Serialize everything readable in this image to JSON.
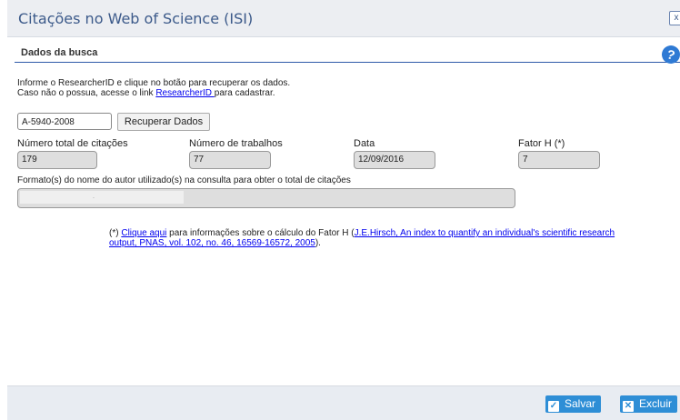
{
  "window": {
    "title": "Citações no Web of Science (ISI)",
    "close_glyph": "x"
  },
  "section": {
    "title": "Dados da busca"
  },
  "info": {
    "line1": "Informe o ResearcherID e clique no botão para recuperar os dados.",
    "line2_prefix": "Caso não o possua, acesse o link ",
    "line2_link": "ResearcherID ",
    "line2_suffix": "para cadastrar."
  },
  "researcher_id": {
    "value": "A-5940-2008"
  },
  "recuperar_button": {
    "label": "Recuperar Dados"
  },
  "fields": {
    "total_citacoes": {
      "label": "Número total de citações",
      "value": "179"
    },
    "num_trabalhos": {
      "label": "Número de trabalhos",
      "value": "77"
    },
    "data": {
      "label": "Data",
      "value": "12/09/2016"
    },
    "fator_h": {
      "label": "Fator H (*)",
      "value": "7"
    }
  },
  "formato": {
    "label": "Formato(s) do nome do autor utilizado(s) na consulta para obter o total de citações",
    "value": "."
  },
  "note": {
    "prefix": "(*) ",
    "link1": "Clique aqui",
    "middle": " para informações sobre o cálculo do Fator H (",
    "link2": "J.E.Hirsch, An index to quantify an individual's scientific research output, PNAS, vol. 102, no. 46, 16569-16572, 2005",
    "suffix": ")."
  },
  "footer": {
    "save_label": "Salvar",
    "delete_label": "Excluir"
  },
  "icons": {
    "help": "help-icon",
    "save": "check-icon",
    "delete": "x-icon"
  }
}
